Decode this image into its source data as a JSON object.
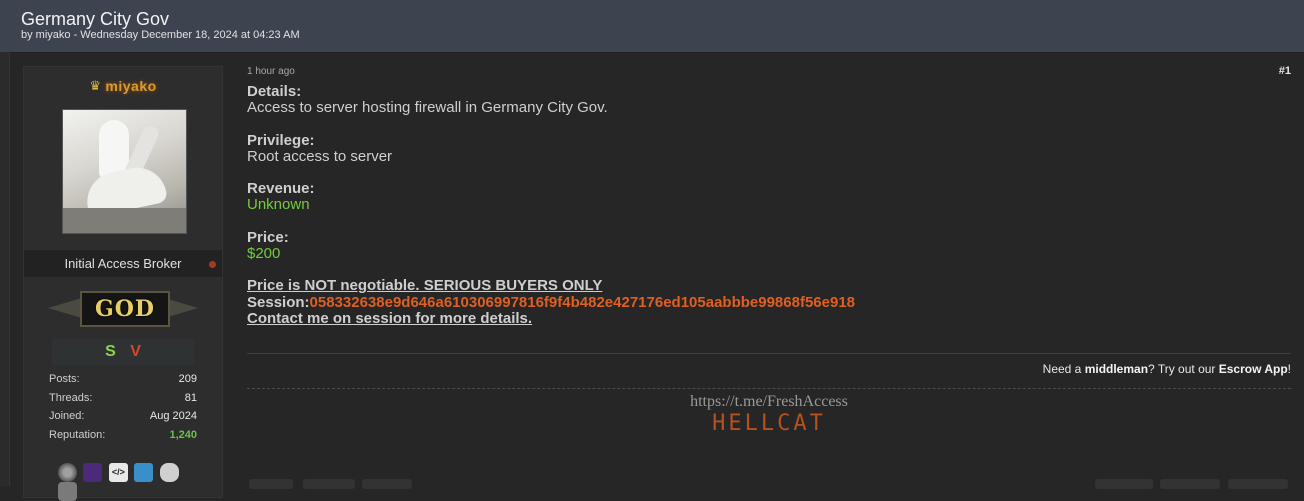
{
  "thread": {
    "title": "Germany City Gov",
    "meta": "by miyako - Wednesday December 18, 2024 at 04:23 AM"
  },
  "user": {
    "username": "miyako",
    "crown_icon": "crown-icon",
    "usertitle": "Initial Access Broker",
    "rank": "GOD",
    "badges": [
      "S",
      "V"
    ],
    "stats": [
      {
        "label": "Posts:",
        "value": "209"
      },
      {
        "label": "Threads:",
        "value": "81"
      },
      {
        "label": "Joined:",
        "value": "Aug 2024"
      },
      {
        "label": "Reputation:",
        "value": "1,240"
      }
    ],
    "awards": [
      "medal-icon",
      "purple-badge-icon",
      "code-tag-icon",
      "laptop-icon",
      "gamepad-icon",
      "chat-bubbles-icon"
    ],
    "award_code_text": "</>"
  },
  "post": {
    "time": "1 hour ago",
    "number": "#1",
    "details_label": "Details:",
    "details_value": "Access to server hosting firewall in Germany City Gov.",
    "privilege_label": "Privilege:",
    "privilege_value": "Root access to server",
    "revenue_label": "Revenue:",
    "revenue_value": "Unknown",
    "price_label": "Price:",
    "price_value": "$200",
    "notice": "Price is NOT negotiable. SERIOUS BUYERS ONLY",
    "session_label": "Session:",
    "session_id": "058332638e9d646a610306997816f9f4b482e427176ed105aabbbe99868f56e918",
    "contact": "Contact me on session for more details."
  },
  "escrow": {
    "prefix": "Need a ",
    "middleman": "middleman",
    "middle": "? Try out our ",
    "app": "Escrow App",
    "suffix": "!"
  },
  "signature": {
    "link": "https://t.me/FreshAccess",
    "brand": "HELLCAT"
  },
  "colors": {
    "header_bg": "#3d4450",
    "accent_green": "#72cc3f",
    "session_orange": "#e05f22",
    "rank_gold": "#e8cf63"
  }
}
